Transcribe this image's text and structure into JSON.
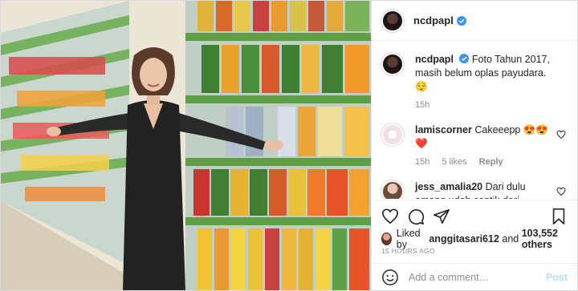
{
  "header": {
    "username": "ncdpapl"
  },
  "caption": {
    "username": "ncdpapl",
    "text": "Foto Tahun 2017, masih belum oplas payudara. 😌",
    "time": "15h"
  },
  "comments": [
    {
      "username": "lamiscorner",
      "text": "Cakeeepp 😍😍❤️",
      "time": "15h",
      "likes": "5 likes",
      "reply": "Reply"
    },
    {
      "username": "jess_amalia20",
      "text": "Dari dulu emang udah cantik dari sananyaaa😍",
      "time": "",
      "likes": "",
      "reply": ""
    }
  ],
  "likes": {
    "prefix": "Liked by",
    "user": "anggitasari612",
    "and": "and",
    "count": "103,552 others"
  },
  "timestamp": "15 HOURS AGO",
  "add_comment": {
    "placeholder": "Add a comment…",
    "post_label": "Post"
  },
  "colors": {
    "verified": "#3897f0",
    "link_post": "#b2dffc",
    "muted": "#8e8e8e",
    "text": "#262626"
  }
}
